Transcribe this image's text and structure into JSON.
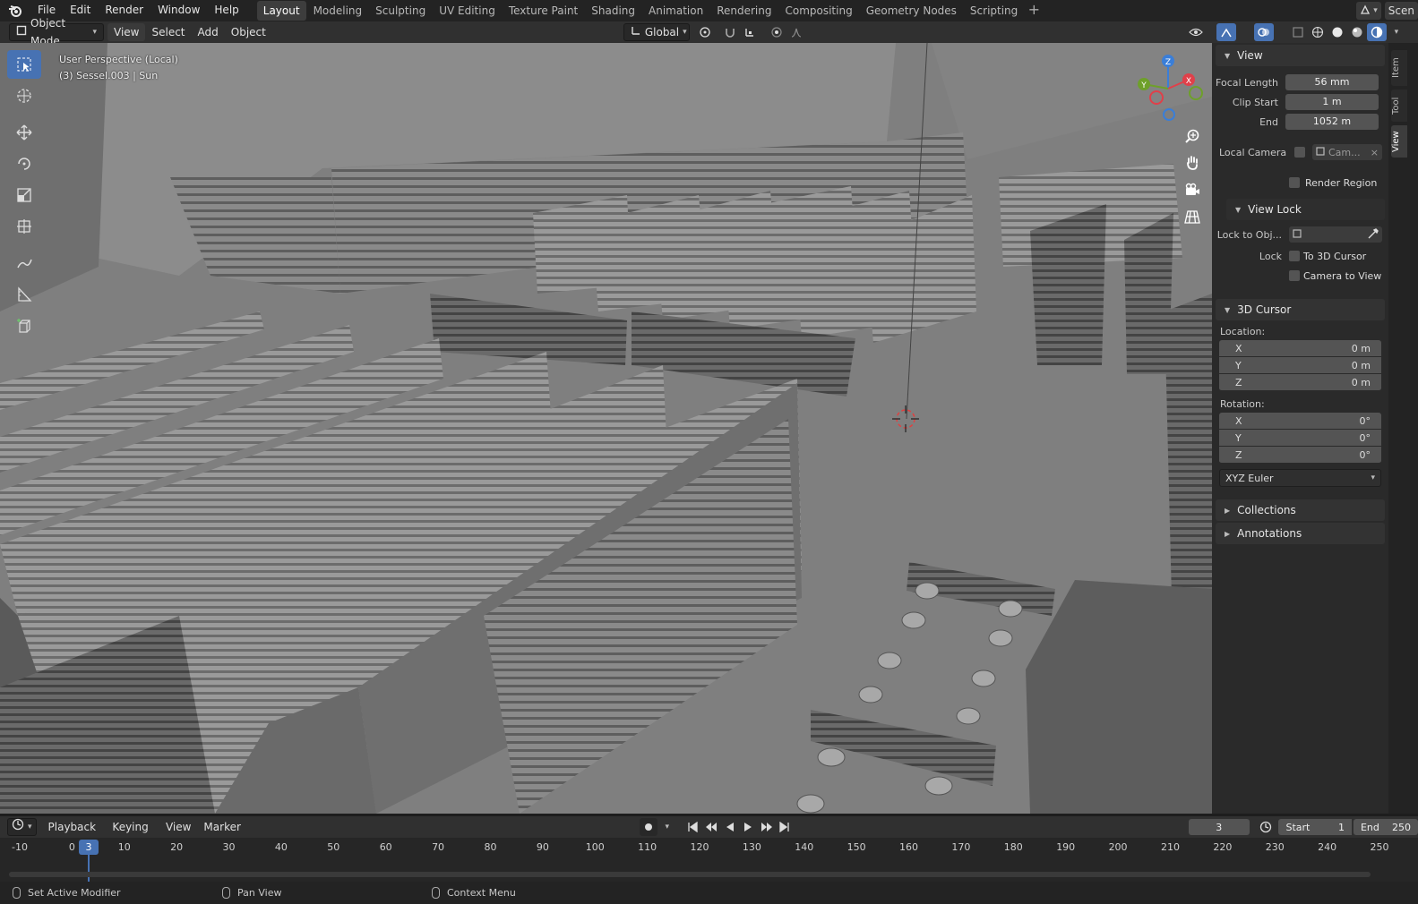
{
  "menu": {
    "items": [
      "File",
      "Edit",
      "Render",
      "Window",
      "Help"
    ]
  },
  "workspaces": {
    "tabs": [
      "Layout",
      "Modeling",
      "Sculpting",
      "UV Editing",
      "Texture Paint",
      "Shading",
      "Animation",
      "Rendering",
      "Compositing",
      "Geometry Nodes",
      "Scripting"
    ],
    "active": "Layout"
  },
  "scene": {
    "label": "Scen"
  },
  "viewport_header": {
    "mode": "Object Mode",
    "menus": [
      "View",
      "Select",
      "Add",
      "Object"
    ],
    "orientation": "Global"
  },
  "viewport": {
    "perspective": "User Perspective (Local)",
    "object_info": "(3) Sessel.003 | Sun"
  },
  "gizmo": {
    "x": "X",
    "y": "Y",
    "z": "Z"
  },
  "sidebar": {
    "tabs": [
      "Item",
      "Tool",
      "View"
    ],
    "active_tab": "View",
    "view": {
      "title": "View",
      "focal_length_label": "Focal Length",
      "focal_length": "56 mm",
      "clip_start_label": "Clip Start",
      "clip_start": "1 m",
      "clip_end_label": "End",
      "clip_end": "1052 m",
      "local_camera_label": "Local Camera",
      "local_camera_value": "Cam...",
      "render_region_label": "Render Region"
    },
    "view_lock": {
      "title": "View Lock",
      "lock_to_obj_label": "Lock to Obj...",
      "lock_label": "Lock",
      "to_3d_cursor": "To 3D Cursor",
      "camera_to_view": "Camera to View"
    },
    "cursor": {
      "title": "3D Cursor",
      "location_label": "Location:",
      "location": [
        {
          "axis": "X",
          "value": "0 m"
        },
        {
          "axis": "Y",
          "value": "0 m"
        },
        {
          "axis": "Z",
          "value": "0 m"
        }
      ],
      "rotation_label": "Rotation:",
      "rotation": [
        {
          "axis": "X",
          "value": "0°"
        },
        {
          "axis": "Y",
          "value": "0°"
        },
        {
          "axis": "Z",
          "value": "0°"
        }
      ],
      "rotation_mode": "XYZ Euler"
    },
    "collections_title": "Collections",
    "annotations_title": "Annotations"
  },
  "timeline": {
    "menus": [
      "Playback",
      "Keying",
      "View",
      "Marker"
    ],
    "current_frame": "3",
    "start_label": "Start",
    "start": "1",
    "end_label": "End",
    "end": "250",
    "ruler": [
      "-10",
      "0",
      "10",
      "20",
      "30",
      "40",
      "50",
      "60",
      "70",
      "80",
      "90",
      "100",
      "110",
      "120",
      "130",
      "140",
      "150",
      "160",
      "170",
      "180",
      "190",
      "200",
      "210",
      "220",
      "230",
      "240",
      "250"
    ],
    "marker_frame": "3"
  },
  "status": {
    "left": "Set Active Modifier",
    "middle": "Pan View",
    "right": "Context Menu"
  },
  "colors": {
    "accent": "#4772b3",
    "x_axis": "#e0404a",
    "y_axis": "#6ea02a",
    "z_axis": "#3a7ed8"
  }
}
